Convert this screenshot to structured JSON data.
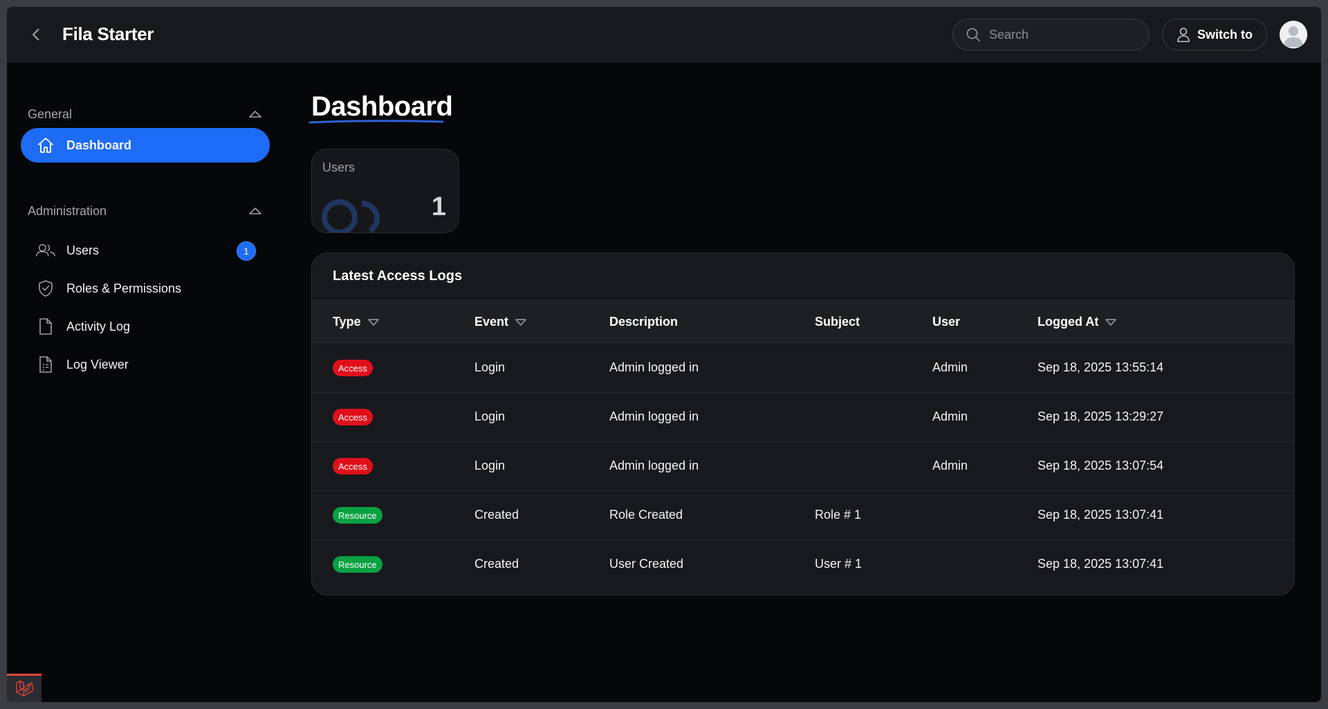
{
  "app": {
    "title": "Fila Starter"
  },
  "topbar": {
    "search_placeholder": "Search",
    "switch_label": "Switch to"
  },
  "sidebar": {
    "groups": [
      {
        "label": "General",
        "items": [
          {
            "label": "Dashboard",
            "icon": "home-icon",
            "active": true
          }
        ]
      },
      {
        "label": "Administration",
        "items": [
          {
            "label": "Users",
            "icon": "users-icon",
            "badge": "1"
          },
          {
            "label": "Roles & Permissions",
            "icon": "shield-check-icon"
          },
          {
            "label": "Activity Log",
            "icon": "document-icon"
          },
          {
            "label": "Log Viewer",
            "icon": "document-list-icon"
          }
        ]
      }
    ]
  },
  "main": {
    "page_title": "Dashboard",
    "stats": [
      {
        "label": "Users",
        "value": "1",
        "icon": "users-icon"
      }
    ],
    "access_logs": {
      "title": "Latest Access Logs",
      "columns": [
        "Type",
        "Event",
        "Description",
        "Subject",
        "User",
        "Logged At"
      ],
      "rows": [
        {
          "type": "Access",
          "event": "Login",
          "description": "Admin logged in",
          "subject": "",
          "user": "Admin",
          "logged_at": "Sep 18, 2025 13:55:14"
        },
        {
          "type": "Access",
          "event": "Login",
          "description": "Admin logged in",
          "subject": "",
          "user": "Admin",
          "logged_at": "Sep 18, 2025 13:29:27"
        },
        {
          "type": "Access",
          "event": "Login",
          "description": "Admin logged in",
          "subject": "",
          "user": "Admin",
          "logged_at": "Sep 18, 2025 13:07:54"
        },
        {
          "type": "Resource",
          "event": "Created",
          "description": "Role Created",
          "subject": "Role # 1",
          "user": "",
          "logged_at": "Sep 18, 2025 13:07:41"
        },
        {
          "type": "Resource",
          "event": "Created",
          "description": "User Created",
          "subject": "User # 1",
          "user": "",
          "logged_at": "Sep 18, 2025 13:07:41"
        }
      ]
    }
  },
  "colors": {
    "accent": "#1d6cf5",
    "access_badge": "#e0101b",
    "resource_badge": "#0aa142",
    "background": "#060709",
    "surface": "#18191c"
  }
}
